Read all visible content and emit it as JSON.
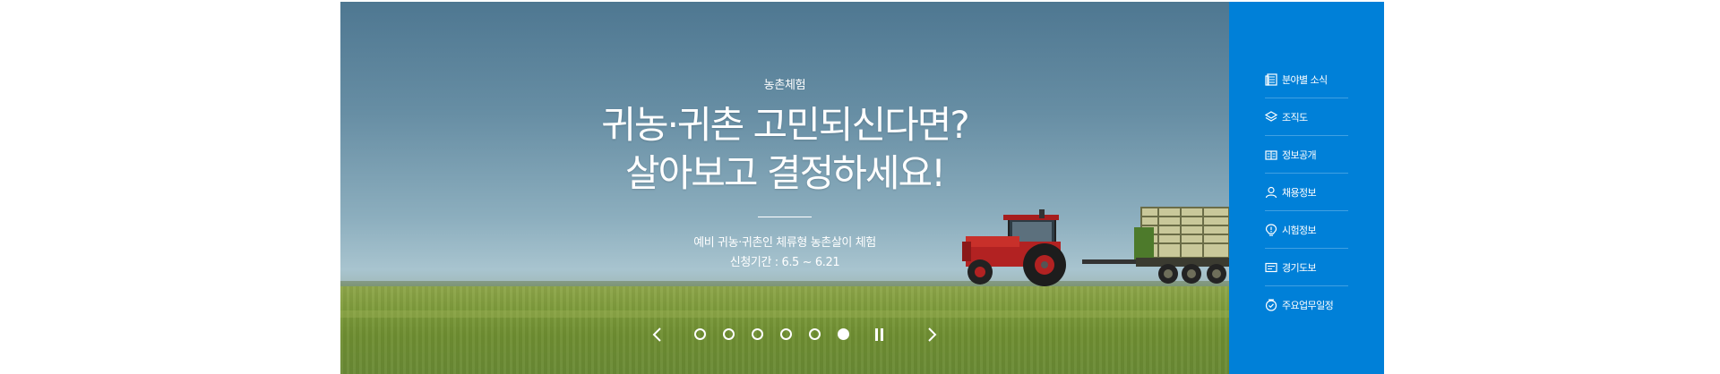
{
  "hero": {
    "category": "농촌체험",
    "headline_line1": "귀농·귀촌 고민되신다면?",
    "headline_line2": "살아보고 결정하세요!",
    "sub_line1": "예비 귀농·귀촌인 체류형 농촌살이 체험",
    "sub_line2": "신청기간 : 6.5 ~ 6.21",
    "slide_count": 6,
    "active_slide": 6,
    "prev_icon": "chevron-left-icon",
    "next_icon": "chevron-right-icon",
    "pause_icon": "pause-icon"
  },
  "sidebar": {
    "background": "#0080d8",
    "items": [
      {
        "label": "분야별 소식",
        "icon": "news-icon"
      },
      {
        "label": "조직도",
        "icon": "layers-icon"
      },
      {
        "label": "정보공개",
        "icon": "book-icon"
      },
      {
        "label": "채용정보",
        "icon": "person-icon"
      },
      {
        "label": "시험정보",
        "icon": "alert-bulb-icon"
      },
      {
        "label": "경기도보",
        "icon": "card-icon"
      },
      {
        "label": "주요업무일정",
        "icon": "calendar-check-icon"
      }
    ]
  }
}
